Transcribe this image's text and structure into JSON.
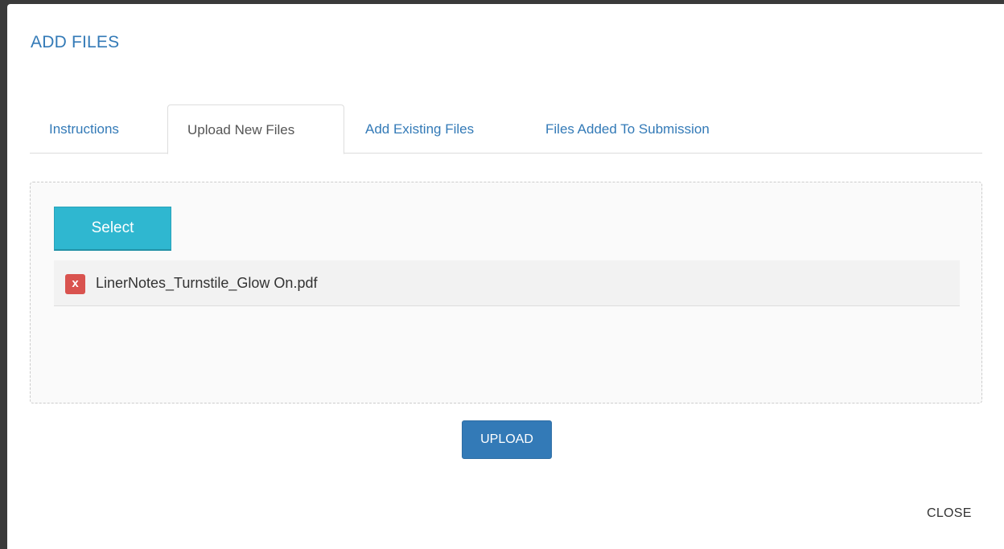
{
  "modal": {
    "title": "ADD FILES",
    "close_label": "CLOSE"
  },
  "tabs": [
    {
      "label": "Instructions",
      "active": false
    },
    {
      "label": "Upload New Files",
      "active": true
    },
    {
      "label": "Add Existing Files",
      "active": false
    },
    {
      "label": "Files Added To Submission",
      "active": false
    }
  ],
  "upload_area": {
    "select_label": "Select",
    "files": [
      {
        "name": "LinerNotes_Turnstile_Glow On.pdf",
        "remove_label": "x"
      }
    ]
  },
  "actions": {
    "upload_label": "UPLOAD"
  },
  "colors": {
    "link": "#337ab7",
    "select_button": "#2fb7d0",
    "remove_icon": "#d9534f",
    "primary_button": "#337ab7"
  }
}
